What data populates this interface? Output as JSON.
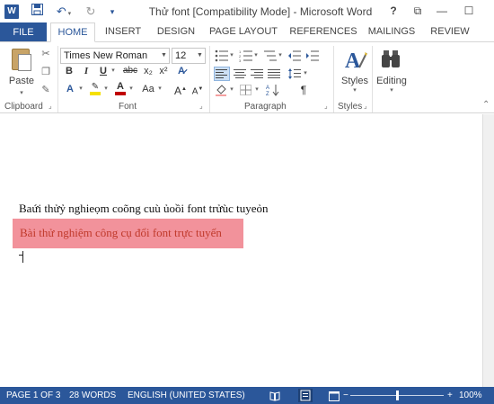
{
  "app": {
    "logo_letter": "W",
    "title": "Thử font [Compatibility Mode] - Microsoft Word"
  },
  "window_buttons": {
    "help": "?",
    "restore_ribbon": "⧉",
    "minimize": "—",
    "maximize": "☐"
  },
  "ribbon_tabs": {
    "file": "FILE",
    "home": "HOME",
    "insert": "INSERT",
    "design": "DESIGN",
    "page_layout": "PAGE LAYOUT",
    "references": "REFERENCES",
    "mailings": "MAILINGS",
    "review": "REVIEW"
  },
  "clipboard": {
    "paste_label": "Paste",
    "group_label": "Clipboard"
  },
  "font": {
    "font_name": "Times New Roman",
    "font_size": "12",
    "bold": "B",
    "italic": "I",
    "underline": "U",
    "strikethrough": "abc",
    "subscript": "x₂",
    "superscript": "x²",
    "change_case": "Aa",
    "grow": "A",
    "shrink": "A",
    "group_label": "Font",
    "highlight_color": "#f5e000",
    "font_color": "#c00000"
  },
  "paragraph": {
    "show_marks": "¶",
    "group_label": "Paragraph"
  },
  "styles": {
    "label": "Styles",
    "group_label": "Styles"
  },
  "editing": {
    "label": "Editing"
  },
  "document": {
    "line1": "Baứi thửỷ nghieọm coõng cuù ủoồi font trửùc tuyeỏn",
    "line2": "Bài thử nghiệm công cụ đổi font trực tuyến",
    "highlight_color": "#f2929b"
  },
  "status_bar": {
    "page": "PAGE 1 OF 3",
    "words": "28 WORDS",
    "language": "ENGLISH (UNITED STATES)",
    "zoom_minus": "−",
    "zoom_plus": "+",
    "zoom": "100%",
    "accent": "#2b579a"
  }
}
